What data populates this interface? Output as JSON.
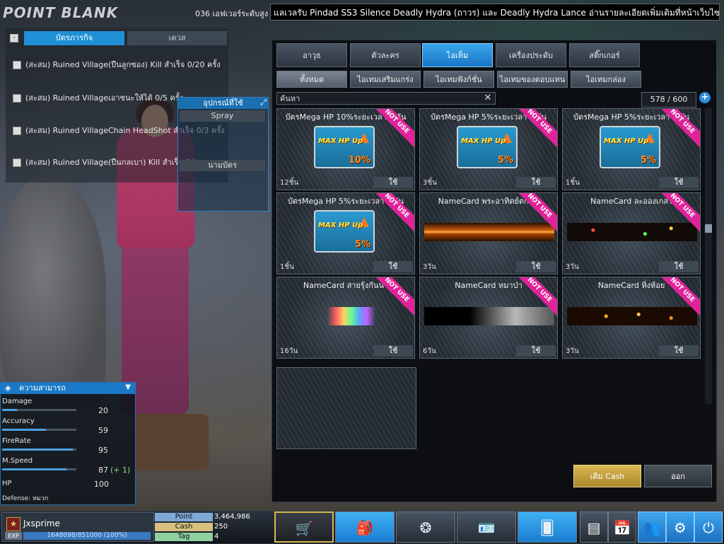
{
  "top": {
    "logo": "POINT BLANK",
    "ticker_label": "036 เอฟเวอร์ระดับสูง",
    "ticker": "แลเวลรับ Pindad SS3 Silence Deadly Hydra (ถาวร) และ Deadly Hydra Lance อ่านรายละเอียดเพิ่มเติมที่หน้าเว็บไซต์"
  },
  "mission": {
    "tabs": [
      "บัตรภารกิจ",
      "เควส"
    ],
    "rows": [
      "(สะสม) Ruined Village(ปืนลูกซอง) Kill สำเร็จ 0/20 ครั้ง",
      "(สะสม) Ruined Villageเอาชนะให้ได้ 0/5 ครั้ง",
      "(สะสม) Ruined VillageChain HeadShot สำเร็จ 0/3 ครั้ง",
      "(สะสม) Ruined Village(ปืนกลเบา) Kill สำเร็จ 0/"
    ]
  },
  "equip": {
    "title": "อุปกรณ์ที่ใช้",
    "spray": "Spray",
    "namecard": "นามบัตร"
  },
  "stats": {
    "title": "ความสามารถ",
    "items": [
      {
        "label": "Damage",
        "value": "20",
        "fill": 0.2
      },
      {
        "label": "Accuracy",
        "value": "59",
        "fill": 0.59
      },
      {
        "label": "FireRate",
        "value": "95",
        "fill": 0.95
      },
      {
        "label": "M.Speed",
        "value": "87",
        "bonus": "(+ 1)",
        "fill": 0.87
      },
      {
        "label": "HP",
        "value": "100"
      }
    ],
    "defense": "Defense: หมวก"
  },
  "shop": {
    "category_tabs": [
      "อาวุธ",
      "ตัวละคร",
      "ไอเท็ม",
      "เครื่องประดับ",
      "สติ๊กเกอร์"
    ],
    "sub_tabs": [
      "ทั้งหมด",
      "ไอเทมเสริมแกร่ง",
      "ไอเทมฟังก์ชั่น",
      "ไอเทมของตอบแทน",
      "ไอเทมกล่อง"
    ],
    "search_placeholder": "ค้นหา",
    "count": "578 / 600",
    "use_label": "ใช้",
    "not_use": "NOT USE",
    "max_hp": "MAX HP Up",
    "items": [
      {
        "name": "บัตรMega HP 10%ระยะเวลา 1 วัน",
        "dur": "12ชิ้น",
        "kind": "hp",
        "pct": "10%"
      },
      {
        "name": "บัตรMega HP 5%ระยะเวลา 1 วัน",
        "dur": "3ชิ้น",
        "kind": "hp",
        "pct": "5%"
      },
      {
        "name": "บัตรMega HP 5%ระยะเวลา 3 วัน",
        "dur": "1ชิ้น",
        "kind": "hp",
        "pct": "5%"
      },
      {
        "name": "บัตรMega HP 5%ระยะเวลา 7 วัน",
        "dur": "1ชิ้น",
        "kind": "hp",
        "pct": "5%"
      },
      {
        "name": "NameCard พระอาทิตย์ตกดิน",
        "dur": "3วัน",
        "kind": "sunset"
      },
      {
        "name": "NameCard ละอองเกสร",
        "dur": "3วัน",
        "kind": "pollen"
      },
      {
        "name": "NameCard สายรุ้งกันน้ำ",
        "dur": "16วัน",
        "kind": "rainbow"
      },
      {
        "name": "NameCard หมาป่า",
        "dur": "6วัน",
        "kind": "wolf"
      },
      {
        "name": "NameCard หิ่งห้อย",
        "dur": "3วัน",
        "kind": "firefly"
      }
    ],
    "add_cash": "เติม Cash",
    "exit": "ออก"
  },
  "player": {
    "name": "Jxsprime",
    "exp_label": "EXP",
    "exp": "1648098/851000 (100%)",
    "point_label": "Point",
    "point": "3,464,986",
    "cash_label": "Cash",
    "cash": "250",
    "tag_label": "Tag",
    "tag": "4"
  }
}
